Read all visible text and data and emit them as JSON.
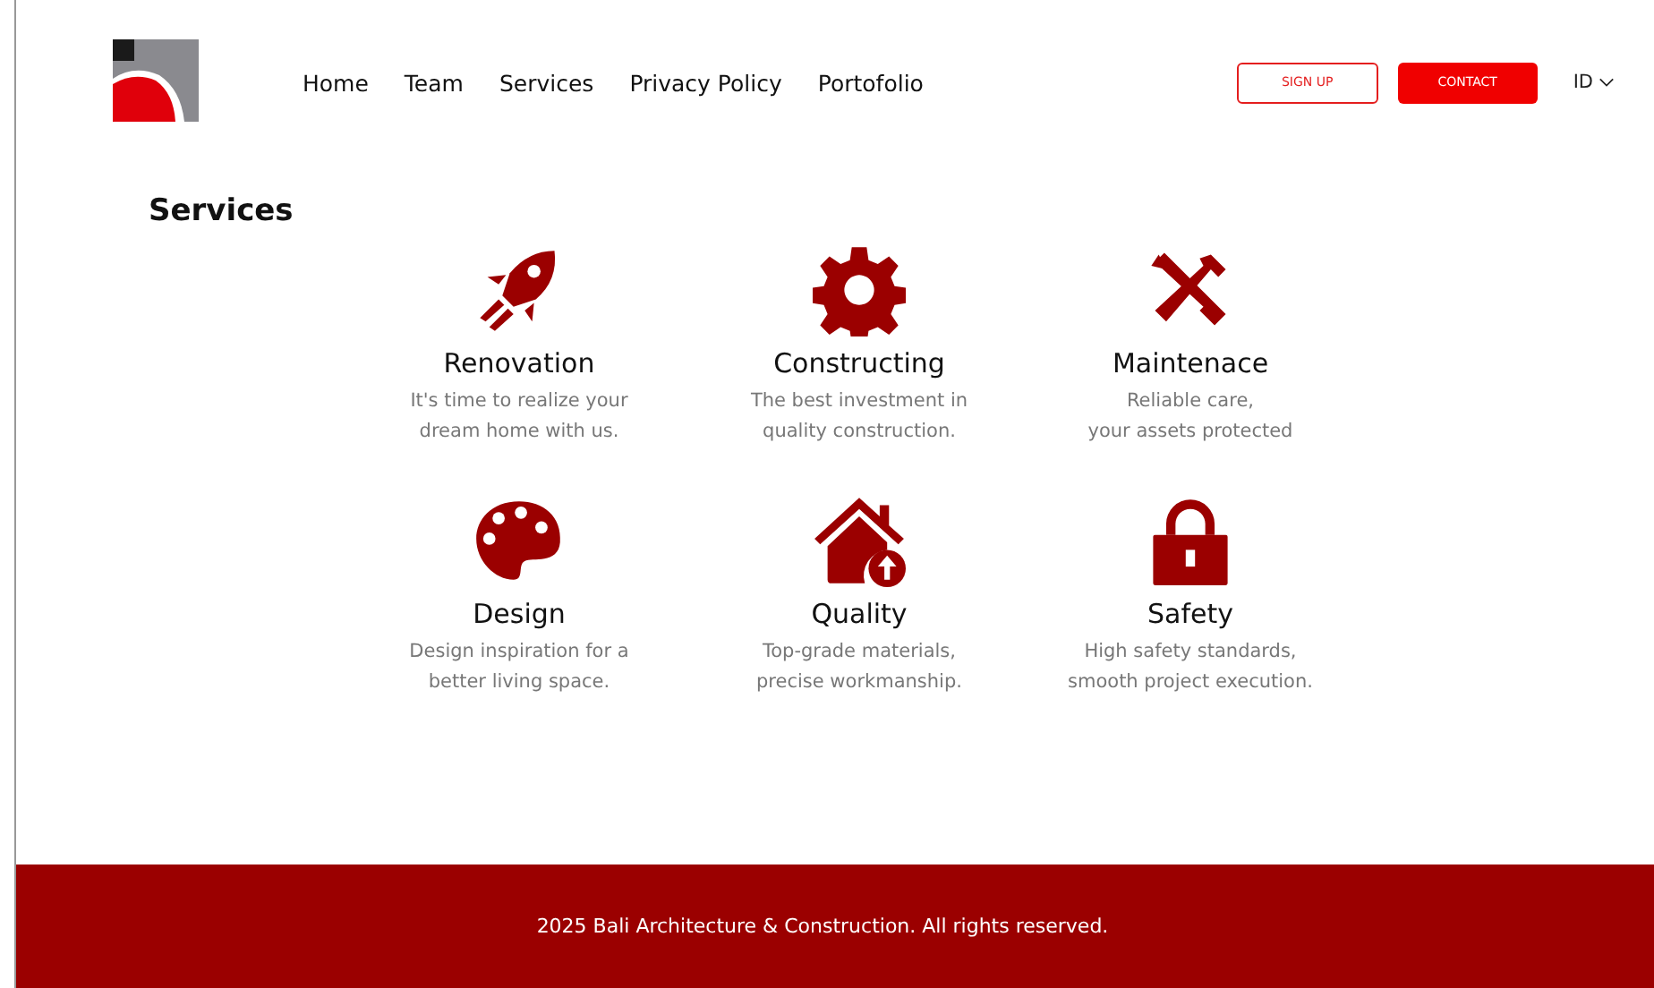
{
  "header": {
    "nav": [
      {
        "label": "Home"
      },
      {
        "label": "Team"
      },
      {
        "label": "Services"
      },
      {
        "label": "Privacy Policy"
      },
      {
        "label": "Portofolio"
      }
    ],
    "sign_up": "SIGN UP",
    "contact": "CONTACT",
    "language": "ID"
  },
  "section_title": "Services",
  "services": [
    {
      "kind": "rocket",
      "title": "Renovation",
      "description": [
        "It's time to realize your",
        "dream home with us."
      ]
    },
    {
      "kind": "gear",
      "title": "Constructing",
      "description": [
        "The best investment in",
        "quality construction."
      ]
    },
    {
      "kind": "tools",
      "title": "Maintenace",
      "description": [
        "Reliable care,",
        "your assets protected"
      ]
    },
    {
      "kind": "palette",
      "title": "Design",
      "description": [
        "Design inspiration for a",
        "better living space."
      ]
    },
    {
      "kind": "house",
      "title": "Quality",
      "description": [
        "Top-grade materials,",
        "precise workmanship."
      ]
    },
    {
      "kind": "lock",
      "title": "Safety",
      "description": [
        "High safety standards,",
        "smooth project execution."
      ]
    }
  ],
  "footer": "2025 Bali Architecture & Construction. All rights reserved."
}
